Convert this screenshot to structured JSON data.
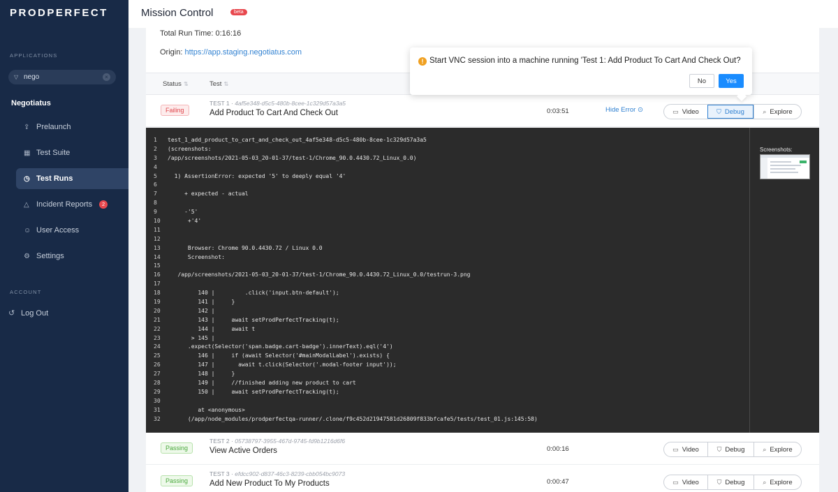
{
  "sidebar": {
    "logo": "PRODPERFECT",
    "applications_label": "APPLICATIONS",
    "search_value": "nego",
    "app_name": "Negotiatus",
    "items": [
      {
        "label": "Prelaunch",
        "icon": "rocket-icon"
      },
      {
        "label": "Test Suite",
        "icon": "grid-icon"
      },
      {
        "label": "Test Runs",
        "icon": "clock-icon",
        "active": true
      },
      {
        "label": "Incident Reports",
        "icon": "warning-icon",
        "badge": "2"
      },
      {
        "label": "User Access",
        "icon": "users-icon"
      },
      {
        "label": "Settings",
        "icon": "gear-icon"
      }
    ],
    "account_label": "ACCOUNT",
    "logout_label": "Log Out"
  },
  "header": {
    "title": "Mission Control",
    "beta": "beta"
  },
  "run": {
    "total_label": "Total Run Time",
    "total_value": "0:16:16",
    "origin_label": "Origin",
    "origin_value": "https://app.staging.negotiatus.com"
  },
  "table": {
    "col_status": "Status",
    "col_test": "Test"
  },
  "tests": [
    {
      "status": "Failing",
      "num": "TEST 1",
      "id": "4af5e348-d5c5-480b-8cee-1c329d57a3a5",
      "name": "Add Product To Cart And Check Out",
      "duration": "0:03:51",
      "hide_error": "Hide Error"
    },
    {
      "status": "Passing",
      "num": "TEST 2",
      "id": "05738797-3955-467d-9745-fd9b1216d6f6",
      "name": "View Active Orders",
      "duration": "0:00:16"
    },
    {
      "status": "Passing",
      "num": "TEST 3",
      "id": "efdcc902-d837-46c3-8239-cbb054bc9073",
      "name": "Add New Product To My Products",
      "duration": "0:00:47"
    }
  ],
  "buttons": {
    "video": "Video",
    "debug": "Debug",
    "explore": "Explore"
  },
  "console": {
    "screenshots_label": "Screenshots:",
    "lines": [
      "test_1_add_product_to_cart_and_check_out_4af5e348-d5c5-480b-8cee-1c329d57a3a5",
      "(screenshots:",
      "/app/screenshots/2021-05-03_20-01-37/test-1/Chrome_90.0.4430.72_Linux_0.0)",
      "",
      "  1) AssertionError: expected '5' to deeply equal '4'",
      "",
      "     + expected - actual",
      "",
      "     -'5'",
      "      +'4'",
      "",
      "",
      "      Browser: Chrome 90.0.4430.72 / Linux 0.0",
      "      Screenshot:",
      "",
      "   /app/screenshots/2021-05-03_20-01-37/test-1/Chrome_90.0.4430.72_Linux_0.0/testrun-3.png",
      "",
      "         140 |         .click('input.btn-default');",
      "         141 |     }",
      "         142 |",
      "         143 |     await setProdPerfectTracking(t);",
      "         144 |     await t",
      "       > 145 |",
      "      .expect(Selector('span.badge.cart-badge').innerText).eql('4')",
      "         146 |     if (await Selector('#mainModalLabel').exists) {",
      "         147 |       await t.click(Selector('.modal-footer input'));",
      "         148 |     }",
      "         149 |     //finished adding new product to cart",
      "         150 |     await setProdPerfectTracking(t);",
      "",
      "         at <anonymous>",
      "      (/app/node_modules/prodperfectqa-runner/.clone/f9c452d21947581d26809f833bfcafe5/tests/test_01.js:145:58)"
    ]
  },
  "popover": {
    "message": "Start VNC session into a machine running 'Test 1: Add Product To Cart And Check Out?",
    "no": "No",
    "yes": "Yes"
  }
}
